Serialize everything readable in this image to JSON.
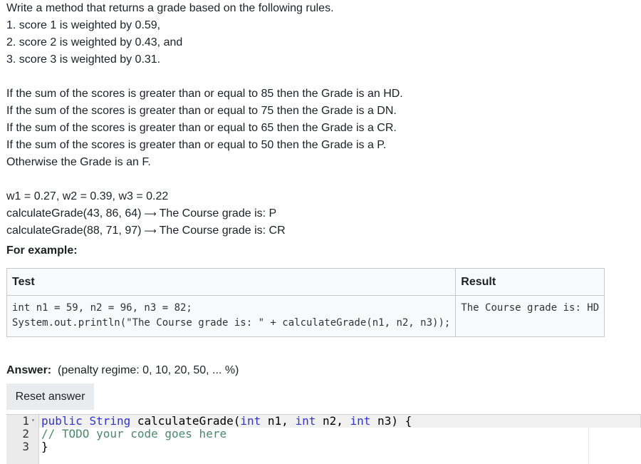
{
  "question": {
    "intro": "Write a method that returns a grade based on the following rules.",
    "rules": [
      "1. score 1 is weighted by 0.59,",
      "2. score 2 is weighted by 0.43, and",
      "3. score 3 is weighted by 0.31."
    ],
    "conditions": [
      "If the sum of the scores is greater than or equal to 85 then the Grade is an HD.",
      "If the sum of the scores is greater than or equal to 75 then the Grade is a DN.",
      "If the sum of the scores is greater than or equal to 65 then the Grade is a CR.",
      "If the sum of the scores is greater than or equal to 50 then the Grade is a P.",
      "Otherwise the Grade is an F."
    ],
    "weights": "w1 = 0.27, w2 = 0.39, w3 = 0.22",
    "examples": [
      {
        "call": "calculateGrade(43, 86, 64)",
        "arrow": "⟶",
        "result": "The Course grade is: P"
      },
      {
        "call": "calculateGrade(88, 71, 97)",
        "arrow": "⟶",
        "result": "The Course grade is: CR"
      }
    ],
    "for_example": "For example:"
  },
  "table": {
    "headers": [
      "Test",
      "Result"
    ],
    "rows": [
      {
        "test": "int n1 = 59, n2 = 96, n3 = 82;\nSystem.out.println(\"The Course grade is: \" + calculateGrade(n1, n2, n3));",
        "result": "The Course grade is: HD"
      }
    ]
  },
  "answer": {
    "label": "Answer:",
    "penalty": "(penalty regime: 0, 10, 20, 50, ... %)",
    "reset_label": "Reset answer"
  },
  "editor": {
    "line_numbers": [
      "1",
      "2",
      "3"
    ],
    "fold_icon": "▾",
    "line1": {
      "kw1": "public",
      "t1": " ",
      "kw2": "String",
      "t2": " calculateGrade(",
      "kw3": "int",
      "t3": " n1, ",
      "kw4": "int",
      "t4": " n2, ",
      "kw5": "int",
      "t5": " n3) {"
    },
    "line2": "// TODO your code goes here",
    "line3": "}",
    "colors": {
      "keyword": "#3333cc",
      "comment": "#4c886b"
    }
  }
}
